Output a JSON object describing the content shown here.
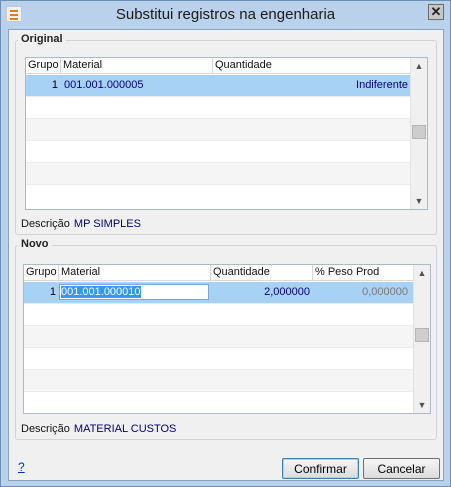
{
  "window": {
    "title": "Substitui registros na engenharia",
    "close_glyph": "✕",
    "app_icon": "app-icon"
  },
  "original": {
    "group_title": "Original",
    "columns": [
      "Grupo",
      "Material",
      "Quantidade"
    ],
    "rows": [
      {
        "grupo": "1",
        "material": "001.001.000005",
        "quantidade": "Indiferente"
      }
    ],
    "description_label": "Descrição",
    "description_value": "MP SIMPLES"
  },
  "novo": {
    "group_title": "Novo",
    "columns": [
      "Grupo",
      "Material",
      "Quantidade",
      "% Peso Prod"
    ],
    "rows": [
      {
        "grupo": "1",
        "material": "001.001.000010",
        "quantidade": "2,000000",
        "peso": "0,000000"
      }
    ],
    "description_label": "Descrição",
    "description_value": "MATERIAL CUSTOS"
  },
  "footer": {
    "help": "?",
    "confirm": "Confirmar",
    "cancel": "Cancelar"
  },
  "colors": {
    "selection": "#a8d2f5",
    "value_text": "#000080",
    "link": "#0033cc"
  }
}
